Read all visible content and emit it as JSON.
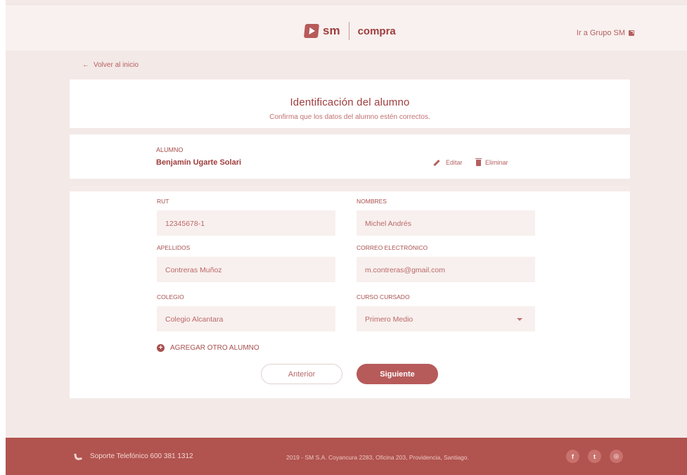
{
  "header": {
    "logo_sm": "sm",
    "logo_compra": "compra",
    "grupo_link": "Ir a Grupo SM"
  },
  "nav": {
    "back_label": "Volver al inicio",
    "back_arrow": "←"
  },
  "intro": {
    "title": "Identificación del alumno",
    "subtitle": "Confirma que los datos del alumno estén correctos."
  },
  "student": {
    "label": "ALUMNO",
    "name": "Benjamín Ugarte Solari",
    "edit_label": "Editar",
    "delete_label": "Eliminar"
  },
  "form": {
    "rut": {
      "label": "RUT",
      "value": "12345678-1"
    },
    "nombres": {
      "label": "NOMBRES",
      "value": "Michel Andrés"
    },
    "apellidos": {
      "label": "APELLIDOS",
      "value": "Contreras Muñoz"
    },
    "correo": {
      "label": "CORREO ELECTRÓNICO",
      "value": "m.contreras@gmail.com"
    },
    "colegio": {
      "label": "COLEGIO",
      "value": "Colegio Alcantara"
    },
    "curso": {
      "label": "CURSO CURSADO",
      "value": "Primero Medio"
    },
    "add_student": "AGREGAR OTRO ALUMNO",
    "prev_label": "Anterior",
    "next_label": "Siguiente"
  },
  "footer": {
    "phone": "Soporte Telefónico 600 381 1312",
    "address": "2019 - SM S.A. Coyancura 2283, Oficina 203, Providencia, Santiago.",
    "social": [
      "f",
      "t",
      "◎"
    ]
  },
  "colors": {
    "accent": "#b75a5a",
    "footer": "#b1534f",
    "background": "#f3e9e7"
  },
  "icons": [
    "play-logo-icon",
    "external-link-icon",
    "arrow-left-icon",
    "pencil-icon",
    "trash-icon",
    "plus-circle-icon",
    "chevron-down-icon",
    "phone-icon",
    "facebook-icon",
    "twitter-icon",
    "instagram-icon"
  ]
}
